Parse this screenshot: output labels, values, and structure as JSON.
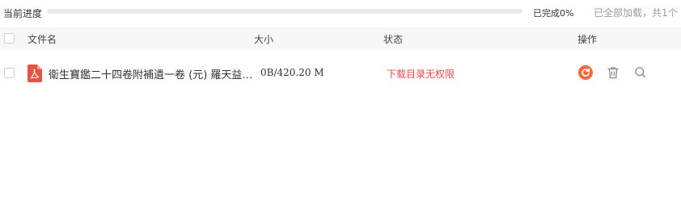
{
  "progress": {
    "label": "当前进度",
    "fraction": 0,
    "percent_text": "已完成0%",
    "fill_color": "#f26a3a"
  },
  "summary": "已全部加载，共1个",
  "table": {
    "headers": {
      "name": "文件名",
      "size": "大小",
      "status": "状态",
      "actions": "操作"
    },
    "rows": [
      {
        "icon": "pdf-file-icon",
        "name": "衛生寶鑑二十四卷附補遺一卷 (元) 羅天益 撰",
        "size": "0B/420.20 M",
        "status": "下载目录无权限",
        "status_color": "#e8474c",
        "actions": [
          "retry-icon",
          "trash-icon",
          "search-icon"
        ]
      }
    ]
  },
  "colors": {
    "accent": "#f26a3a",
    "error": "#e8474c"
  }
}
